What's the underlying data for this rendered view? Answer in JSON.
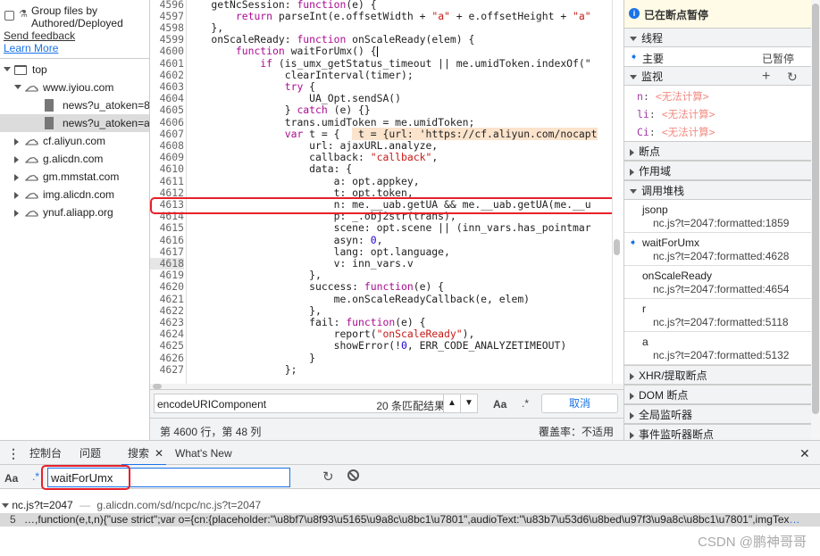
{
  "left": {
    "group_label": "Group files by Authored/Deployed",
    "send_feedback": "Send feedback",
    "learn_more": "Learn More",
    "tree": [
      {
        "label": "top",
        "icon": "frame-icon",
        "level": 0,
        "expanded": true
      },
      {
        "label": "www.iyiou.com",
        "icon": "cloud-icon",
        "level": 1,
        "expanded": true
      },
      {
        "label": "news?u_atoken=8c6",
        "icon": "file-icon",
        "level": 2
      },
      {
        "label": "news?u_atoken=ab2",
        "icon": "file-icon",
        "level": 2,
        "selected": true
      },
      {
        "label": "cf.aliyun.com",
        "icon": "cloud-icon",
        "level": 1,
        "expanded": false
      },
      {
        "label": "g.alicdn.com",
        "icon": "cloud-icon",
        "level": 1,
        "expanded": false
      },
      {
        "label": "gm.mmstat.com",
        "icon": "cloud-icon",
        "level": 1,
        "expanded": false
      },
      {
        "label": "img.alicdn.com",
        "icon": "cloud-icon",
        "level": 1,
        "expanded": false
      },
      {
        "label": "ynuf.aliapp.org",
        "icon": "cloud-icon",
        "level": 1,
        "expanded": false
      }
    ]
  },
  "editor": {
    "current_line": "4618",
    "highlight_line": "4613",
    "lines": [
      {
        "n": "4596",
        "seg": [
          [
            "    getNcSession: ",
            ""
          ],
          [
            "function",
            "kw"
          ],
          [
            "(e) {",
            ""
          ]
        ]
      },
      {
        "n": "4597",
        "seg": [
          [
            "        ",
            ""
          ],
          [
            "return",
            "kw"
          ],
          [
            " parseInt(e.offsetWidth + ",
            ""
          ],
          [
            "\"a\"",
            "str"
          ],
          [
            " + e.offsetHeight + ",
            ""
          ],
          [
            "\"a\"",
            "str"
          ]
        ]
      },
      {
        "n": "4598",
        "seg": [
          [
            "    },",
            ""
          ]
        ]
      },
      {
        "n": "4599",
        "seg": [
          [
            "    onScaleReady: ",
            ""
          ],
          [
            "function",
            "kw"
          ],
          [
            " onScaleReady(elem) {",
            ""
          ]
        ]
      },
      {
        "n": "4600",
        "seg": [
          [
            "        ",
            ""
          ],
          [
            "function",
            "kw"
          ],
          [
            " waitForUmx() {",
            ""
          ]
        ]
      },
      {
        "n": "4601",
        "seg": [
          [
            "            ",
            ""
          ],
          [
            "if",
            "kw"
          ],
          [
            " (is_umx_getStatus_timeout || me.umidToken.indexOf(\"",
            ""
          ]
        ]
      },
      {
        "n": "4602",
        "seg": [
          [
            "                clearInterval(timer);",
            ""
          ]
        ]
      },
      {
        "n": "4603",
        "seg": [
          [
            "                ",
            ""
          ],
          [
            "try",
            "kw"
          ],
          [
            " {",
            ""
          ]
        ]
      },
      {
        "n": "4604",
        "seg": [
          [
            "                    UA_Opt.sendSA()",
            ""
          ]
        ]
      },
      {
        "n": "4605",
        "seg": [
          [
            "                } ",
            ""
          ],
          [
            "catch",
            "kw"
          ],
          [
            " (e) {}",
            ""
          ]
        ]
      },
      {
        "n": "4606",
        "seg": [
          [
            "                trans.umidToken = me.umidToken;",
            ""
          ]
        ]
      },
      {
        "n": "4607",
        "seg": [
          [
            "                ",
            ""
          ],
          [
            "var",
            "kw"
          ],
          [
            " t = {  ",
            ""
          ],
          [
            " t = {url: 'https://cf.aliyun.com/nocapt",
            "hl"
          ]
        ]
      },
      {
        "n": "4608",
        "seg": [
          [
            "                    url: ajaxURL.analyze,",
            ""
          ]
        ]
      },
      {
        "n": "4609",
        "seg": [
          [
            "                    callback: ",
            ""
          ],
          [
            "\"callback\"",
            "str"
          ],
          [
            ",",
            ""
          ]
        ]
      },
      {
        "n": "4610",
        "seg": [
          [
            "                    data: {",
            ""
          ]
        ]
      },
      {
        "n": "4611",
        "seg": [
          [
            "                        a: opt.appkey,",
            ""
          ]
        ]
      },
      {
        "n": "4612",
        "seg": [
          [
            "                        t: opt.token,",
            ""
          ]
        ]
      },
      {
        "n": "4613",
        "seg": [
          [
            "                        n: me.__uab.getUA && me.__uab.getUA(me.__u",
            ""
          ]
        ]
      },
      {
        "n": "4614",
        "seg": [
          [
            "                        p: _.obj2str(trans),",
            ""
          ]
        ]
      },
      {
        "n": "4615",
        "seg": [
          [
            "                        scene: opt.scene || (inn_vars.has_pointmar",
            ""
          ]
        ]
      },
      {
        "n": "4616",
        "seg": [
          [
            "                        asyn: ",
            ""
          ],
          [
            "0",
            "num"
          ],
          [
            ",",
            ""
          ]
        ]
      },
      {
        "n": "4617",
        "seg": [
          [
            "                        lang: opt.language,",
            ""
          ]
        ]
      },
      {
        "n": "4618",
        "seg": [
          [
            "                        v: inn_vars.v",
            ""
          ]
        ]
      },
      {
        "n": "4619",
        "seg": [
          [
            "                    },",
            ""
          ]
        ]
      },
      {
        "n": "4620",
        "seg": [
          [
            "                    success: ",
            ""
          ],
          [
            "function",
            "kw"
          ],
          [
            "(e) {",
            ""
          ]
        ]
      },
      {
        "n": "4621",
        "seg": [
          [
            "                        me.onScaleReadyCallback(e, elem)",
            ""
          ]
        ]
      },
      {
        "n": "4622",
        "seg": [
          [
            "                    },",
            ""
          ]
        ]
      },
      {
        "n": "4623",
        "seg": [
          [
            "                    fail: ",
            ""
          ],
          [
            "function",
            "kw"
          ],
          [
            "(e) {",
            ""
          ]
        ]
      },
      {
        "n": "4624",
        "seg": [
          [
            "                        report(",
            ""
          ],
          [
            "\"onScaleReady\"",
            "str"
          ],
          [
            "),",
            ""
          ]
        ]
      },
      {
        "n": "4625",
        "seg": [
          [
            "                        showError(!",
            ""
          ],
          [
            "0",
            "num"
          ],
          [
            ", ERR_CODE_ANALYZETIMEOUT)",
            ""
          ]
        ]
      },
      {
        "n": "4626",
        "seg": [
          [
            "                    }",
            ""
          ]
        ]
      },
      {
        "n": "4627",
        "seg": [
          [
            "                };",
            ""
          ]
        ]
      }
    ],
    "find": {
      "value": "encodeURIComponent",
      "count": "20 条匹配结果",
      "case_label": "Aa",
      "regex_label": ".*",
      "cancel": "取消"
    },
    "status": {
      "position": "第 4600 行，第 48 列",
      "coverage": "覆盖率：不适用"
    }
  },
  "debugger": {
    "paused": "已在断点暂停",
    "threads": "线程",
    "main_thread": "主要",
    "thread_state": "已暂停",
    "watch": "监视",
    "watch_items": [
      {
        "name": "n",
        "value": "<无法计算>"
      },
      {
        "name": "li",
        "value": "<无法计算>"
      },
      {
        "name": "Ci",
        "value": "<无法计算>"
      }
    ],
    "breakpoints": "断点",
    "scope": "作用域",
    "call_stack": "调用堆栈",
    "frames": [
      {
        "fn": "jsonp",
        "loc": "nc.js?t=2047:formatted:1859"
      },
      {
        "fn": "waitForUmx",
        "loc": "nc.js?t=2047:formatted:4628",
        "current": true
      },
      {
        "fn": "onScaleReady",
        "loc": "nc.js?t=2047:formatted:4654"
      },
      {
        "fn": "r",
        "loc": "nc.js?t=2047:formatted:5118"
      },
      {
        "fn": "a",
        "loc": "nc.js?t=2047:formatted:5132"
      }
    ],
    "xhr": "XHR/提取断点",
    "dom": "DOM 断点",
    "global": "全局监听器",
    "event": "事件监听器断点",
    "accent": "#1a73e8",
    "error_color": "#f28b82"
  },
  "drawer": {
    "tabs": [
      "控制台",
      "问题",
      "搜索",
      "What's New"
    ],
    "active_tab": "搜索",
    "case_label": "Aa",
    "regex_label": ".*",
    "query": "waitForUmx",
    "result_file": "nc.js?t=2047",
    "result_url": "g.alicdn.com/sd/ncpc/nc.js?t=2047",
    "result_line": "5",
    "result_text": "…,function(e,t,n){\"use strict\";var o={cn:{placeholder:\"\\u8bf7\\u8f93\\u5165\\u9a8c\\u8bc1\\u7801\",audioText:\"\\u83b7\\u53d6\\u8bed\\u97f3\\u9a8c\\u8bc1\\u7801\",imgTex",
    "ellipsis": "…"
  },
  "watermark": "CSDN @鹏神哥哥",
  "annotation_color": "#e8202a"
}
